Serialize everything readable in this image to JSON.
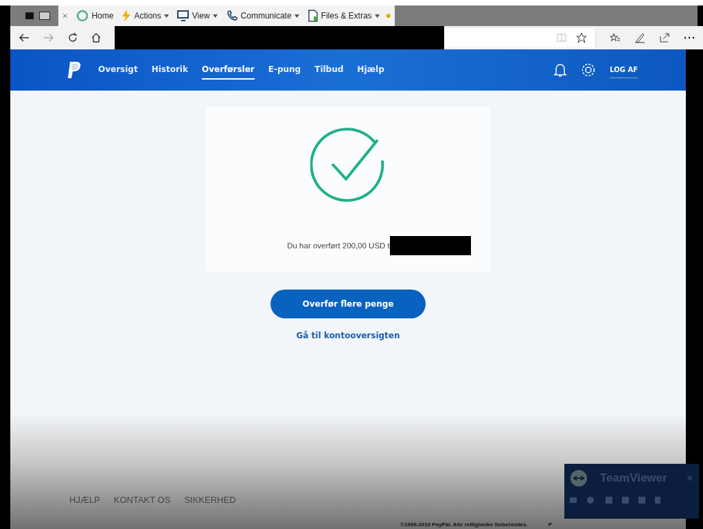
{
  "remote_toolbar": {
    "items": [
      {
        "label": "Home",
        "kind": "home",
        "dropdown": false
      },
      {
        "label": "Actions",
        "kind": "bolt",
        "dropdown": true
      },
      {
        "label": "View",
        "kind": "monitor",
        "dropdown": true
      },
      {
        "label": "Communicate",
        "kind": "phone",
        "dropdown": true
      },
      {
        "label": "Files & Extras",
        "kind": "file",
        "dropdown": true
      }
    ]
  },
  "nav": {
    "items": [
      {
        "label": "Oversigt",
        "selected": false
      },
      {
        "label": "Historik",
        "selected": false
      },
      {
        "label": "Overførsler",
        "selected": true
      },
      {
        "label": "E-pung",
        "selected": false
      },
      {
        "label": "Tilbud",
        "selected": false
      },
      {
        "label": "Hjælp",
        "selected": false
      }
    ],
    "logout": "LOG AF"
  },
  "confirmation": {
    "message": "Du har overført 200,00 USD t"
  },
  "primary_button": "Overfør flere penge",
  "secondary_link": "Gå til kontooversigten",
  "footer": {
    "links": [
      "HJÆLP",
      "KONTAKT OS",
      "SIKKERHED"
    ],
    "copyright": "©1999-2019 PayPal. Alle rettigheder forbeholdes.",
    "extra": "P"
  },
  "teamviewer": {
    "title": "TeamViewer",
    "close": "×"
  }
}
